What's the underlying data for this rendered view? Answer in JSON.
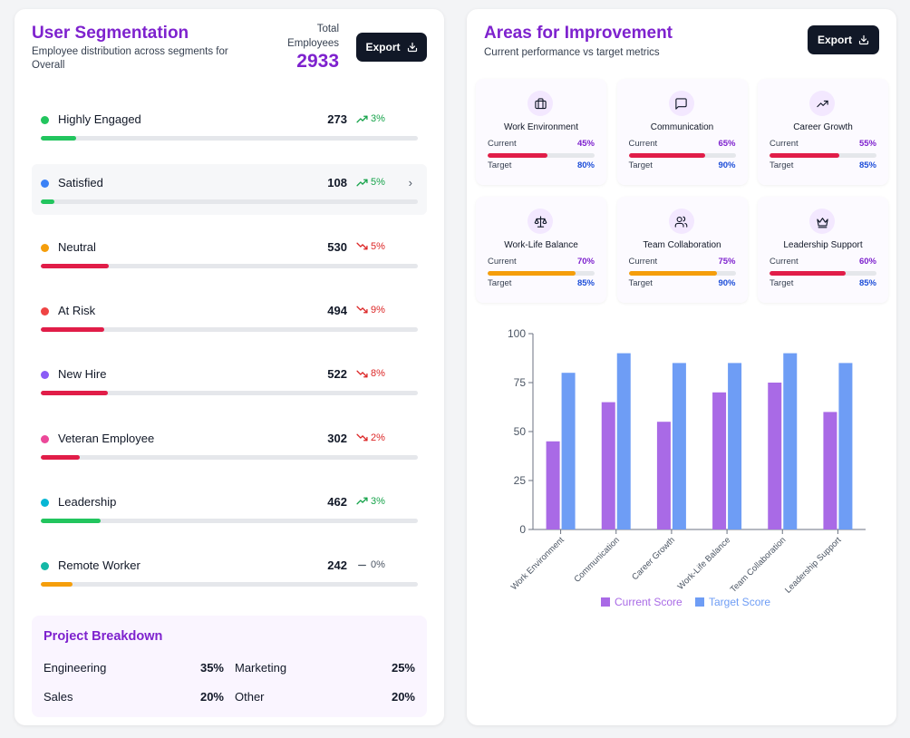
{
  "segmentation": {
    "title": "User Segmentation",
    "subtitle": "Employee distribution across segments for Overall",
    "total_label": "Total Employees",
    "total_value": "2933",
    "export_label": "Export",
    "segments": [
      {
        "label": "Highly Engaged",
        "count": "273",
        "trend": "3%",
        "direction": "up",
        "dot_color": "#22c55e",
        "bar_color": "#22c55e",
        "bar_fraction": 0.093
      },
      {
        "label": "Satisfied",
        "count": "108",
        "trend": "5%",
        "direction": "up",
        "dot_color": "#3b82f6",
        "bar_color": "#22c55e",
        "bar_fraction": 0.037
      },
      {
        "label": "Neutral",
        "count": "530",
        "trend": "5%",
        "direction": "down",
        "dot_color": "#f59e0b",
        "bar_color": "#e11d48",
        "bar_fraction": 0.181
      },
      {
        "label": "At Risk",
        "count": "494",
        "trend": "9%",
        "direction": "down",
        "dot_color": "#ef4444",
        "bar_color": "#e11d48",
        "bar_fraction": 0.168
      },
      {
        "label": "New Hire",
        "count": "522",
        "trend": "8%",
        "direction": "down",
        "dot_color": "#8b5cf6",
        "bar_color": "#e11d48",
        "bar_fraction": 0.178
      },
      {
        "label": "Veteran Employee",
        "count": "302",
        "trend": "2%",
        "direction": "down",
        "dot_color": "#ec4899",
        "bar_color": "#e11d48",
        "bar_fraction": 0.103
      },
      {
        "label": "Leadership",
        "count": "462",
        "trend": "3%",
        "direction": "up",
        "dot_color": "#06b6d4",
        "bar_color": "#22c55e",
        "bar_fraction": 0.158
      },
      {
        "label": "Remote Worker",
        "count": "242",
        "trend": "0%",
        "direction": "flat",
        "dot_color": "#14b8a6",
        "bar_color": "#f59e0b",
        "bar_fraction": 0.083
      }
    ],
    "project_breakdown": {
      "title": "Project Breakdown",
      "items": [
        {
          "label": "Engineering",
          "value": "35%"
        },
        {
          "label": "Marketing",
          "value": "25%"
        },
        {
          "label": "Sales",
          "value": "20%"
        },
        {
          "label": "Other",
          "value": "20%"
        }
      ]
    }
  },
  "improvement": {
    "title": "Areas for Improvement",
    "subtitle": "Current performance vs target metrics",
    "export_label": "Export",
    "current_label": "Current",
    "target_label": "Target",
    "metrics": [
      {
        "name": "Work Environment",
        "icon": "briefcase-icon",
        "current": "45%",
        "target": "80%",
        "current_fraction": 0.56,
        "bar_color": "#e11d48"
      },
      {
        "name": "Communication",
        "icon": "message-square-icon",
        "current": "65%",
        "target": "90%",
        "current_fraction": 0.72,
        "bar_color": "#e11d48"
      },
      {
        "name": "Career Growth",
        "icon": "trending-up-icon",
        "current": "55%",
        "target": "85%",
        "current_fraction": 0.65,
        "bar_color": "#e11d48"
      },
      {
        "name": "Work-Life Balance",
        "icon": "scale-icon",
        "current": "70%",
        "target": "85%",
        "current_fraction": 0.82,
        "bar_color": "#f59e0b"
      },
      {
        "name": "Team Collaboration",
        "icon": "users-icon",
        "current": "75%",
        "target": "90%",
        "current_fraction": 0.83,
        "bar_color": "#f59e0b"
      },
      {
        "name": "Leadership Support",
        "icon": "crown-icon",
        "current": "60%",
        "target": "85%",
        "current_fraction": 0.71,
        "bar_color": "#e11d48"
      }
    ]
  },
  "chart_data": {
    "type": "bar",
    "categories": [
      "Work Environment",
      "Communication",
      "Career Growth",
      "Work-Life Balance",
      "Team Collaboration",
      "Leadership Support"
    ],
    "series": [
      {
        "name": "Current Score",
        "values": [
          45,
          65,
          55,
          70,
          75,
          60
        ],
        "color": "#a96ae6"
      },
      {
        "name": "Target Score",
        "values": [
          80,
          90,
          85,
          85,
          90,
          85
        ],
        "color": "#6e9df5"
      }
    ],
    "yticks": [
      "0",
      "25",
      "50",
      "75",
      "100"
    ],
    "ylim": [
      0,
      100
    ],
    "grid": false,
    "legend": "bottom"
  }
}
